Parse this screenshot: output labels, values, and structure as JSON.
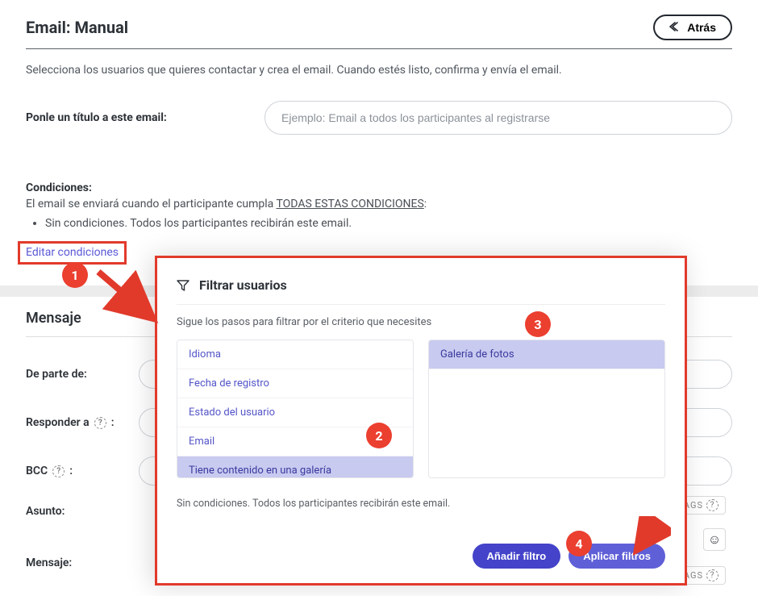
{
  "header": {
    "title": "Email: Manual",
    "back": "Atrás"
  },
  "intro": "Selecciona los usuarios que quieres contactar y crea el email. Cuando estés listo, confirma y envía el email.",
  "titleField": {
    "label": "Ponle un título a este email:",
    "placeholder": "Ejemplo: Email a todos los participantes al registrarse"
  },
  "conditions": {
    "head": "Condiciones:",
    "line1a": "El email se enviará cuando el participante cumpla ",
    "line1b": "TODAS ESTAS CONDICIONES",
    "bullet": "Sin condiciones. Todos los participantes recibirán este email.",
    "edit": "Editar condiciones"
  },
  "message": {
    "section": "Mensaje",
    "from": "De parte de:",
    "reply": "Responder a",
    "bcc": "BCC",
    "subject": "Asunto:",
    "body": "Mensaje:",
    "tagsChip": "TAGS"
  },
  "popover": {
    "title": "Filtrar usuarios",
    "sub": "Sigue los pasos para filtrar por el criterio que necesites",
    "status": "Sin condiciones. Todos los participantes recibirán este email.",
    "addFilter": "Añadir filtro",
    "applyFilters": "Aplicar filtros",
    "leftList": [
      "Idioma",
      "Fecha de registro",
      "Estado del usuario",
      "Email",
      "Tiene contenido en una galería"
    ],
    "rightList": [
      "Galería de fotos"
    ]
  },
  "badges": {
    "b1": "1",
    "b2": "2",
    "b3": "3",
    "b4": "4"
  }
}
